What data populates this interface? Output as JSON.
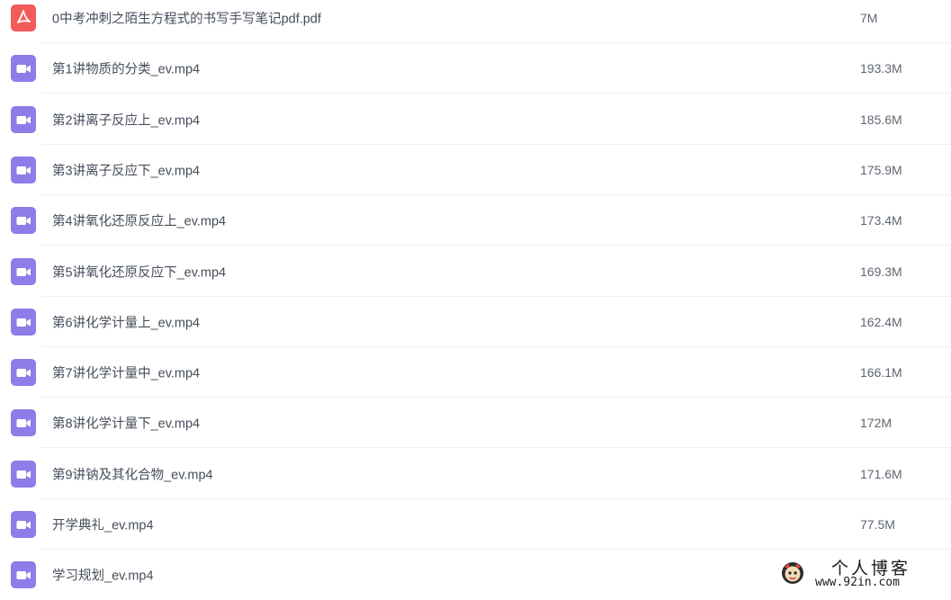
{
  "colors": {
    "pdf_icon": "#f35b5b",
    "video_icon": "#8d7de8",
    "text": "#454d5a",
    "size_text": "#5f6672",
    "separator": "#eef0f4"
  },
  "files": [
    {
      "name": "0中考冲刺之陌生方程式的书写手写笔记pdf.pdf",
      "size": "7M",
      "type": "pdf",
      "icon": "pdf-icon"
    },
    {
      "name": "第1讲物质的分类_ev.mp4",
      "size": "193.3M",
      "type": "video",
      "icon": "video-icon"
    },
    {
      "name": "第2讲离子反应上_ev.mp4",
      "size": "185.6M",
      "type": "video",
      "icon": "video-icon"
    },
    {
      "name": "第3讲离子反应下_ev.mp4",
      "size": "175.9M",
      "type": "video",
      "icon": "video-icon"
    },
    {
      "name": "第4讲氧化还原反应上_ev.mp4",
      "size": "173.4M",
      "type": "video",
      "icon": "video-icon"
    },
    {
      "name": "第5讲氧化还原反应下_ev.mp4",
      "size": "169.3M",
      "type": "video",
      "icon": "video-icon"
    },
    {
      "name": "第6讲化学计量上_ev.mp4",
      "size": "162.4M",
      "type": "video",
      "icon": "video-icon"
    },
    {
      "name": "第7讲化学计量中_ev.mp4",
      "size": "166.1M",
      "type": "video",
      "icon": "video-icon"
    },
    {
      "name": "第8讲化学计量下_ev.mp4",
      "size": "172M",
      "type": "video",
      "icon": "video-icon"
    },
    {
      "name": "第9讲钠及其化合物_ev.mp4",
      "size": "171.6M",
      "type": "video",
      "icon": "video-icon"
    },
    {
      "name": "开学典礼_ev.mp4",
      "size": "77.5M",
      "type": "video",
      "icon": "video-icon"
    },
    {
      "name": "学习规划_ev.mp4",
      "size": "",
      "type": "video",
      "icon": "video-icon"
    }
  ],
  "watermark": {
    "title": "个人博客",
    "url": "www.92in.com",
    "icon": "mascot-icon"
  }
}
